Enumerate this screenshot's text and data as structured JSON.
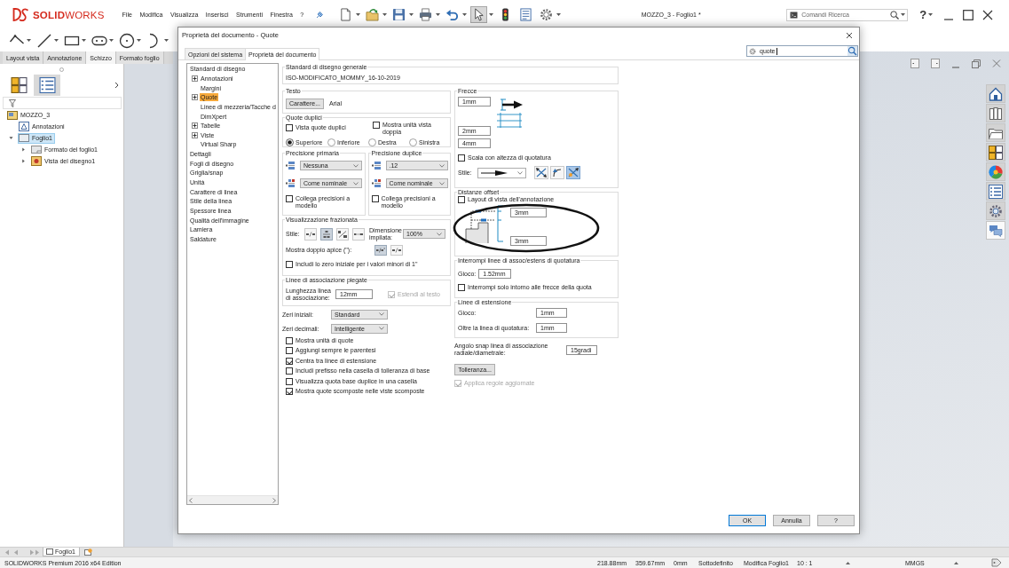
{
  "app": {
    "logo": "**SOLID**WORKS",
    "menu": [
      "File",
      "Modifica",
      "Visualizza",
      "Inserisci",
      "Strumenti",
      "Finestra",
      "?"
    ],
    "toolbar": [
      {
        "kind": "new",
        "selected": false
      },
      {
        "kind": "open",
        "selected": false
      },
      {
        "kind": "save",
        "selected": false
      },
      {
        "kind": "print",
        "selected": false
      },
      {
        "kind": "undo",
        "selected": false
      },
      {
        "kind": "select",
        "selected": true
      },
      {
        "kind": "rebuild",
        "selected": false
      },
      {
        "kind": "properties",
        "selected": false
      },
      {
        "kind": "options",
        "selected": false
      }
    ],
    "document_title": "MOZZO_3 - Foglio1 *",
    "command_search": {
      "placeholder": "Comandi Ricerca"
    },
    "help": "?"
  },
  "command_tabs": [
    {
      "label": "Layout vista",
      "selected": false
    },
    {
      "label": "Annotazione",
      "selected": false
    },
    {
      "label": "Schizzo",
      "selected": true
    },
    {
      "label": "Formato foglio",
      "selected": false
    }
  ],
  "feature_manager": {
    "panel_tabs": [
      {
        "kind": "tree",
        "selected": false
      },
      {
        "kind": "list",
        "selected": true
      }
    ],
    "tree": [
      {
        "label": "MOZZO_3",
        "kind": "drawing",
        "selected": false,
        "children": [
          {
            "label": "Annotazioni",
            "kind": "annotations",
            "selected": false
          },
          {
            "label": "Foglio1",
            "kind": "sheet",
            "selected": true,
            "expanded": true,
            "children": [
              {
                "label": "Formato del foglio1",
                "kind": "sheet-format",
                "selected": false,
                "expanded": false
              },
              {
                "label": "Vista del disegno1",
                "kind": "view",
                "selected": false,
                "expanded": false
              }
            ]
          }
        ]
      }
    ]
  },
  "dialog": {
    "title": "Proprietà del documento - Quote",
    "tabs": [
      {
        "label": "Opzioni del sistema",
        "selected": false
      },
      {
        "label": "Proprietà del documento",
        "selected": true
      }
    ],
    "search": {
      "value": "quote"
    },
    "nav": [
      {
        "label": "Standard di disegno",
        "selected": false,
        "children": [
          {
            "label": "Annotazioni",
            "selected": false,
            "expanded": false
          },
          {
            "label": "Margini",
            "selected": false
          },
          {
            "label": "Quote",
            "selected": true,
            "expanded": false
          },
          {
            "label": "Linee di mezzeria/Tacche d",
            "selected": false
          },
          {
            "label": "DimXpert",
            "selected": false
          },
          {
            "label": "Tabelle",
            "selected": false,
            "expanded": false
          },
          {
            "label": "Viste",
            "selected": false,
            "expanded": false
          },
          {
            "label": "Virtual Sharp",
            "selected": false
          }
        ]
      },
      {
        "label": "Dettagli",
        "selected": false
      },
      {
        "label": "Fogli di disegno",
        "selected": false
      },
      {
        "label": "Griglia/snap",
        "selected": false
      },
      {
        "label": "Unità",
        "selected": false
      },
      {
        "label": "Carattere di linea",
        "selected": false
      },
      {
        "label": "Stile della linea",
        "selected": false
      },
      {
        "label": "Spessore linea",
        "selected": false
      },
      {
        "label": "Qualità dell'immagine",
        "selected": false
      },
      {
        "label": "Lamiera",
        "selected": false
      },
      {
        "label": "Saldature",
        "selected": false
      }
    ],
    "general_standard": {
      "title": "Standard di disegno generale",
      "value": "ISO-MODIFICATO_MOMMY_16-10-2019"
    },
    "text": {
      "title": "Testo",
      "font_button": "Carattere...",
      "font": "Arial"
    },
    "dual_dimensions": {
      "title": "Quote duplici",
      "options": [
        {
          "label": "Vista quote duplici",
          "checked": false
        },
        {
          "label": "Mostra unità vista doppia",
          "checked": false
        }
      ],
      "positions": [
        {
          "label": "Superiore",
          "selected": true
        },
        {
          "label": "Inferiore",
          "selected": false
        },
        {
          "label": "Destra",
          "selected": false
        },
        {
          "label": "Sinistra",
          "selected": false
        }
      ]
    },
    "precision": [
      {
        "title": "Precisione primaria",
        "value": "Nessuna",
        "tolerance": "Come nominale",
        "link": {
          "label": "Collega precisioni a modello",
          "checked": false
        }
      },
      {
        "title": "Precisione duplice",
        "value": ".12",
        "tolerance": "Come nominale",
        "link": {
          "label": "Collega precisioni a modello",
          "checked": false
        }
      }
    ],
    "fraction_display": {
      "title": "Visualizzazione frazionata",
      "style_label": "Stile:",
      "styles": [
        {
          "kind": "inline",
          "selected": false
        },
        {
          "kind": "stacked",
          "selected": true
        },
        {
          "kind": "diagonal",
          "selected": false
        },
        {
          "kind": "linear",
          "selected": false
        }
      ],
      "stack_size_label": "Dimensione impilata:",
      "stack_size": "100%",
      "double_prime_label": "Mostra doppio apice (\"):",
      "double_prime": [
        {
          "kind": "prime",
          "selected": true
        },
        {
          "kind": "plain",
          "selected": false
        }
      ],
      "leading_zero": {
        "label": "Includi lo zero iniziale per i valori minori di 1\"",
        "checked": false
      }
    },
    "bent_leaders": {
      "title": "Linee di associazione piegate",
      "length_label": "Lunghezza linea di associazione:",
      "length": "12mm",
      "extend": {
        "label": "Estendi al testo",
        "checked": true,
        "disabled": true
      }
    },
    "zeros": [
      {
        "label": "Zeri iniziali:",
        "value": "Standard"
      },
      {
        "label": "Zeri decimali:",
        "value": "Intelligente"
      }
    ],
    "options": [
      {
        "label": "Mostra unità di quote",
        "checked": false
      },
      {
        "label": "Aggiungi sempre le parentesi",
        "checked": false
      },
      {
        "label": "Centra tra linee di estensione",
        "checked": true
      },
      {
        "label": "Includi prefisso nella casella di tolleranza di base",
        "checked": false
      },
      {
        "label": "Visualizza quota base duplice in una casella",
        "checked": false
      },
      {
        "label": "Mostra quote scomposte nelle viste scomposte",
        "checked": true
      }
    ],
    "arrows": {
      "title": "Frecce",
      "sizes": [
        "1mm",
        "2mm",
        "4mm"
      ],
      "scale": {
        "label": "Scala con altezza di quotatura",
        "checked": false
      },
      "style_label": "Stile:",
      "placement": [
        {
          "kind": "outside",
          "selected": false
        },
        {
          "kind": "inside",
          "selected": false
        },
        {
          "kind": "smart",
          "selected": true
        }
      ]
    },
    "offset_distances": {
      "title": "Distanze offset",
      "layout": {
        "label": "Layout di vista dell'annotazione",
        "checked": false
      },
      "values": [
        "3mm",
        "3mm"
      ]
    },
    "break_lines": {
      "title": "Interrompi linee di assoc/estens di quotatura",
      "gap_label": "Gioco:",
      "gap": "1.52mm",
      "arrows_only": {
        "label": "Interrompi solo intorno alle frecce della quota",
        "checked": false
      }
    },
    "extension_lines": {
      "title": "Linee di estensione",
      "rows": [
        {
          "label": "Gioco:",
          "value": "1mm"
        },
        {
          "label": "Oltre la linea di quotatura:",
          "value": "1mm"
        }
      ]
    },
    "snap_angle": {
      "label": "Angolo snap linea di associazione radiale/diametrale:",
      "value": "15gradi"
    },
    "tolerance_button": "Tolleranza...",
    "apply_rules": {
      "label": "Applica regole aggiornate",
      "checked": true,
      "disabled": true
    },
    "buttons": [
      {
        "label": "OK",
        "kind": "default"
      },
      {
        "label": "Annulla",
        "kind": "normal"
      },
      {
        "label": "?",
        "kind": "normal"
      }
    ]
  },
  "task_pane": [
    {
      "kind": "home",
      "selected": false
    },
    {
      "kind": "books",
      "selected": false
    },
    {
      "kind": "folder",
      "selected": false
    },
    {
      "kind": "squares",
      "selected": false
    },
    {
      "kind": "sphere",
      "selected": false
    },
    {
      "kind": "list",
      "selected": false
    },
    {
      "kind": "gear",
      "selected": false
    },
    {
      "kind": "chat",
      "selected": true
    }
  ],
  "sheet_tabs": [
    {
      "label": "Foglio1",
      "selected": true
    }
  ],
  "status_bar": {
    "edition": "SOLIDWORKS Premium 2016 x64 Edition",
    "fields": [
      {
        "text": "218.88mm",
        "kind": "text"
      },
      {
        "text": "359.67mm",
        "kind": "text"
      },
      {
        "text": "0mm",
        "kind": "text"
      },
      {
        "text": "Sottodefinito",
        "kind": "text"
      },
      {
        "text": "Modifica Foglio1",
        "kind": "text"
      },
      {
        "text": "10 : 1",
        "kind": "menu"
      },
      {
        "text": "MMGS",
        "kind": "menu"
      }
    ]
  }
}
